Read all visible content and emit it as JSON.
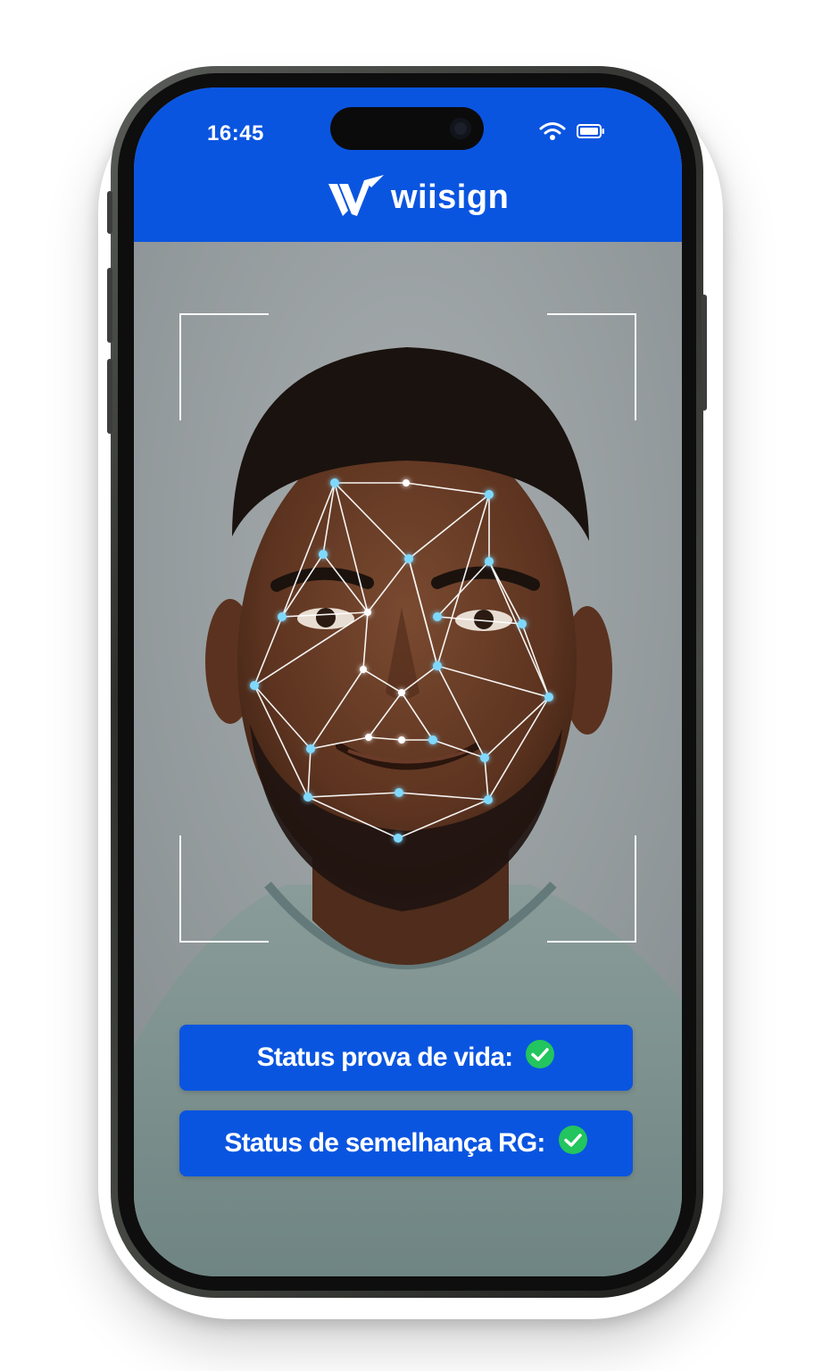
{
  "status_bar": {
    "time": "16:45",
    "icons": [
      "wifi-icon",
      "battery-icon"
    ]
  },
  "header": {
    "brand": "wiisign",
    "logo_icon": "wiisign-w-logo",
    "background_color": "#0a55e0"
  },
  "camera_view": {
    "frame": "face-detection-frame",
    "overlay": "facial-landmark-mesh"
  },
  "status_cards": [
    {
      "label": "Status prova de vida:",
      "icon": "check-circle-icon",
      "icon_color": "#22c55e"
    },
    {
      "label": "Status de semelhança RG:",
      "icon": "check-circle-icon",
      "icon_color": "#22c55e"
    }
  ]
}
